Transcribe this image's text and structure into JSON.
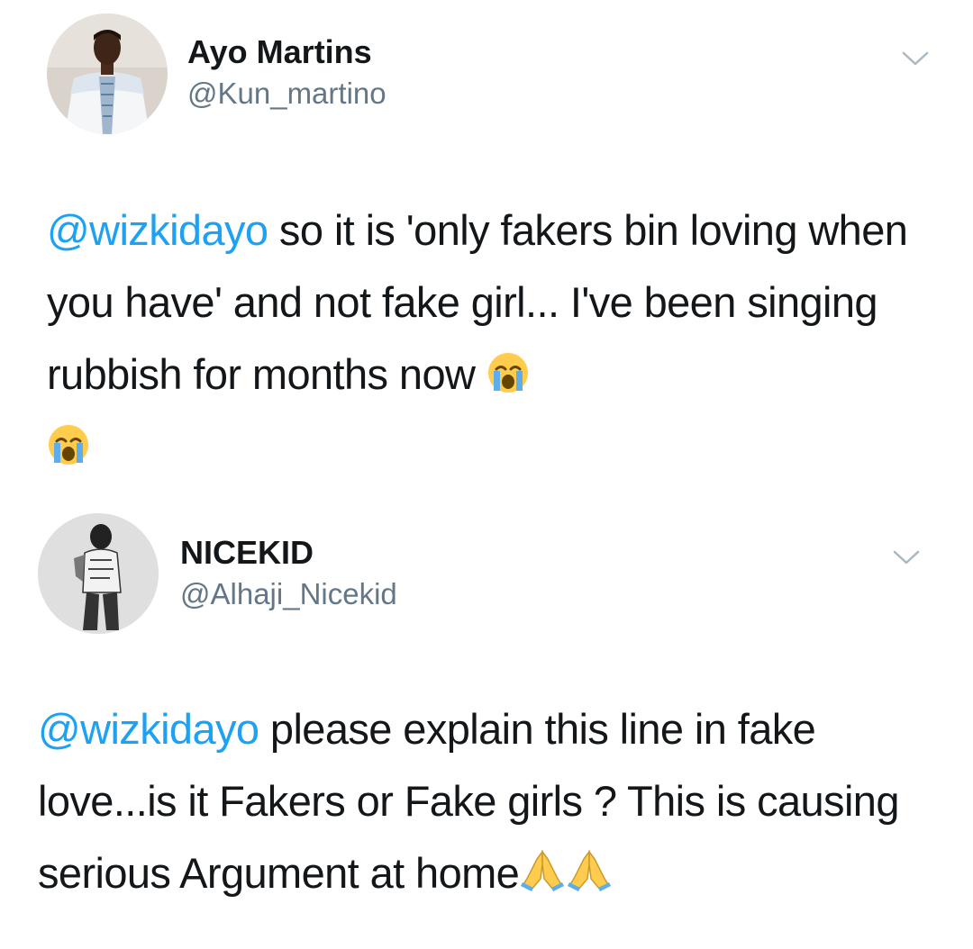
{
  "tweets": [
    {
      "author": {
        "name": "Ayo Martins",
        "handle": "@Kun_martino",
        "avatar_icon": "user-avatar-photo"
      },
      "mention": "@wizkidayo",
      "text": " so it is 'only fakers bin loving when you have' and not fake girl... I've been singing rubbish for months now ",
      "emojis": [
        "loudly-crying-face",
        "loudly-crying-face"
      ],
      "menu_icon": "chevron-down-icon"
    },
    {
      "author": {
        "name": "NICEKID",
        "handle": "@Alhaji_Nicekid",
        "avatar_icon": "user-avatar-photo"
      },
      "mention": "@wizkidayo",
      "text": " please explain this line in fake love...is it Fakers or Fake girls ? This is causing serious Argument at home",
      "emojis": [
        "folded-hands",
        "folded-hands"
      ],
      "menu_icon": "chevron-down-icon"
    }
  ],
  "colors": {
    "text": "#14171a",
    "handle": "#657786",
    "link": "#1da1f2",
    "chevron": "#aab8c2"
  }
}
